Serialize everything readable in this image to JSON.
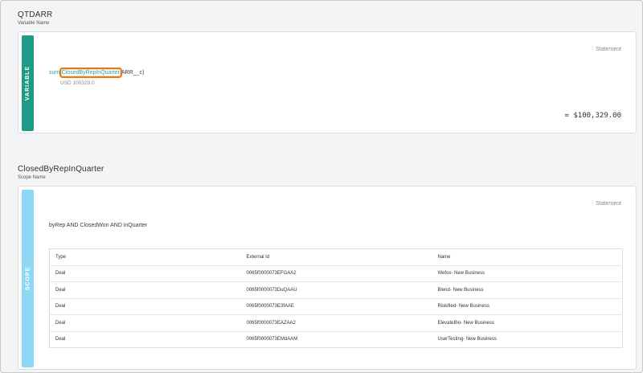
{
  "variable": {
    "name": "QTDARR",
    "subtitle": "Variable Name",
    "tag": "VARIABLE",
    "statement_label": "Statement",
    "formula": {
      "prefix": "sum(",
      "scope": "ClosedByRepInQuarter",
      "suffix": ".ARR__c)"
    },
    "formula_value": "USD 100329.0",
    "total": "= $100,329.00"
  },
  "scope": {
    "name": "ClosedByRepInQuarter",
    "subtitle": "Scope Name",
    "tag": "SCOPE",
    "statement_label": "Statement",
    "expression": "byRep AND ClosedWon AND inQuarter",
    "table": {
      "headers": [
        "Type",
        "External Id",
        "Name"
      ],
      "rows": [
        [
          "Deal",
          "0065f0000073EFGAA2",
          "Wefox- New Business"
        ],
        [
          "Deal",
          "0065f0000073DuQAAU",
          "Blend- New Business"
        ],
        [
          "Deal",
          "0065f0000073E3fAAE",
          "Riskified- New Business"
        ],
        [
          "Deal",
          "0065f0000073EAZAA2",
          "ElevateBio- New Business"
        ],
        [
          "Deal",
          "0065f0000073EMdAAM",
          "UserTesting- New Business"
        ]
      ]
    }
  },
  "colors": {
    "variable_tag": "#1e9b87",
    "scope_tag": "#8fd8f5",
    "highlight": "#e07b1f",
    "accent_text": "#2ba6a2"
  }
}
